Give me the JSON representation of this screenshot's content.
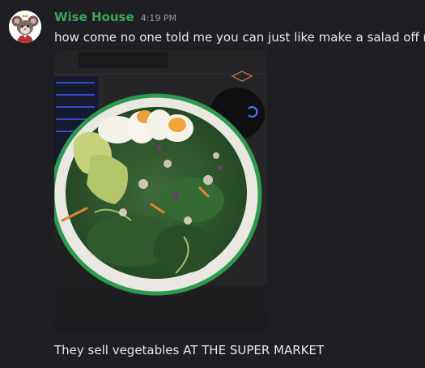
{
  "message": {
    "author": "Wise House",
    "timestamp": "4:19 PM",
    "lines": [
      "how come no one told me you can just like make a salad off rip",
      "They sell vegetables AT THE SUPER MARKET"
    ]
  },
  "avatar": {
    "icon": "mouse-avatar-icon"
  },
  "attachment": {
    "kind": "photo",
    "icon": "salad-bowl-image"
  },
  "colors": {
    "background": "#1f1f23",
    "username": "#3ba55c",
    "timestamp": "#949ba4",
    "text": "#e6e8eb",
    "bowl_rim": "#2f9a4e"
  }
}
